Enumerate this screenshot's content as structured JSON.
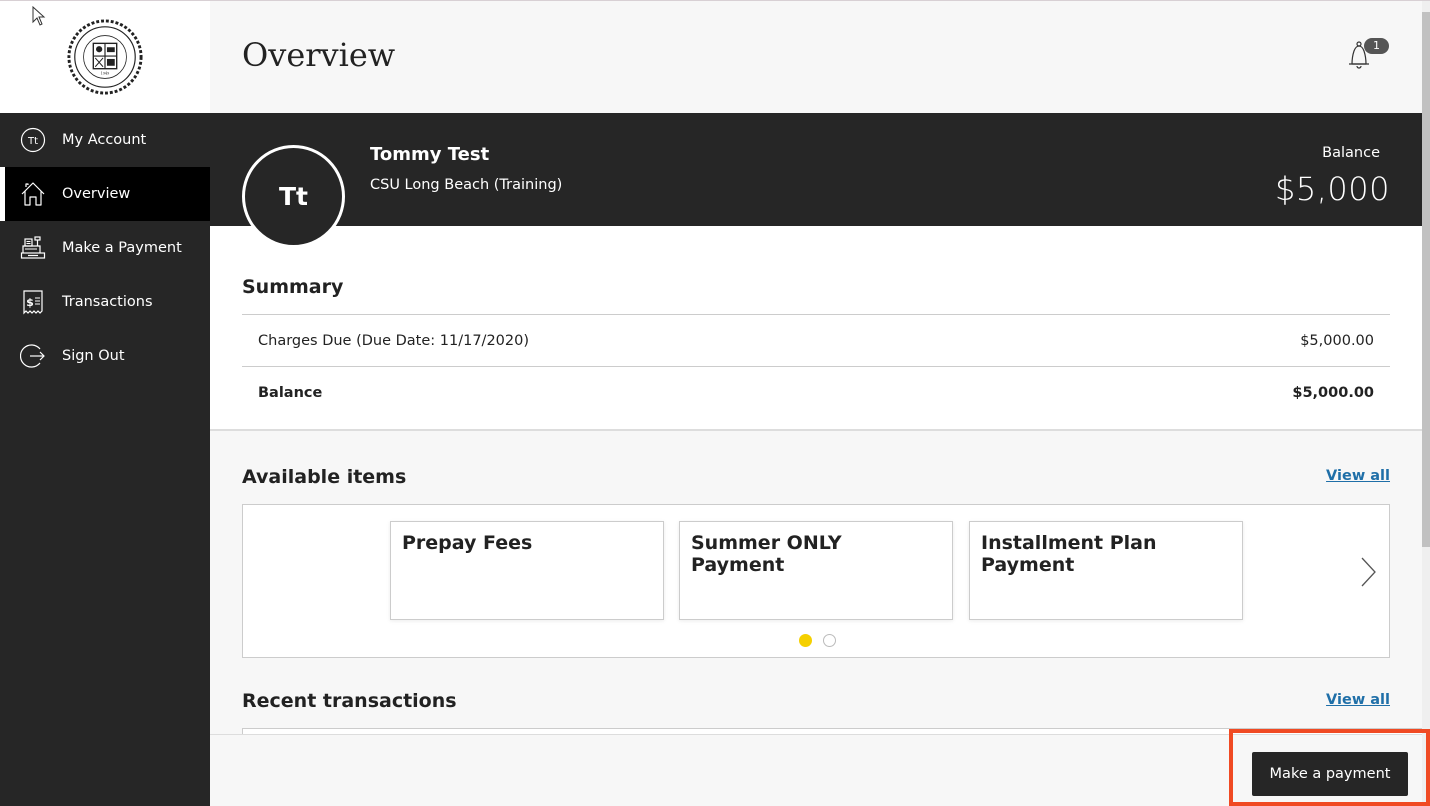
{
  "sidebar": {
    "logo_alt": "California State University Long Beach seal",
    "items": [
      {
        "label": "My Account",
        "icon": "user-initials-icon",
        "initials": "Tt",
        "active": false
      },
      {
        "label": "Overview",
        "icon": "home-icon",
        "active": true
      },
      {
        "label": "Make a Payment",
        "icon": "cash-register-icon",
        "active": false
      },
      {
        "label": "Transactions",
        "icon": "receipt-icon",
        "active": false
      },
      {
        "label": "Sign Out",
        "icon": "sign-out-icon",
        "active": false
      }
    ]
  },
  "header": {
    "title": "Overview",
    "notifications_count": "1"
  },
  "profile": {
    "initials": "Tt",
    "name": "Tommy Test",
    "school": "CSU Long Beach (Training)",
    "balance_label": "Balance",
    "balance_amount": "$5,000"
  },
  "summary": {
    "heading": "Summary",
    "rows": [
      {
        "label": "Charges Due (Due Date: 11/17/2020)",
        "value": "$5,000.00",
        "bold": false
      },
      {
        "label": "Balance",
        "value": "$5,000.00",
        "bold": true
      }
    ]
  },
  "available_items": {
    "heading": "Available items",
    "view_all": "View all",
    "cards": [
      {
        "title": "Prepay Fees"
      },
      {
        "title": "Summer ONLY Payment"
      },
      {
        "title": "Installment Plan Payment"
      }
    ],
    "pages": 2,
    "current_page": 1
  },
  "recent_transactions": {
    "heading": "Recent transactions",
    "view_all": "View all"
  },
  "footer": {
    "make_payment_label": "Make a payment"
  },
  "colors": {
    "sidebar_bg": "#262626",
    "active_dot": "#f5d000",
    "link": "#1f6fa8",
    "highlight": "#f04a23"
  }
}
